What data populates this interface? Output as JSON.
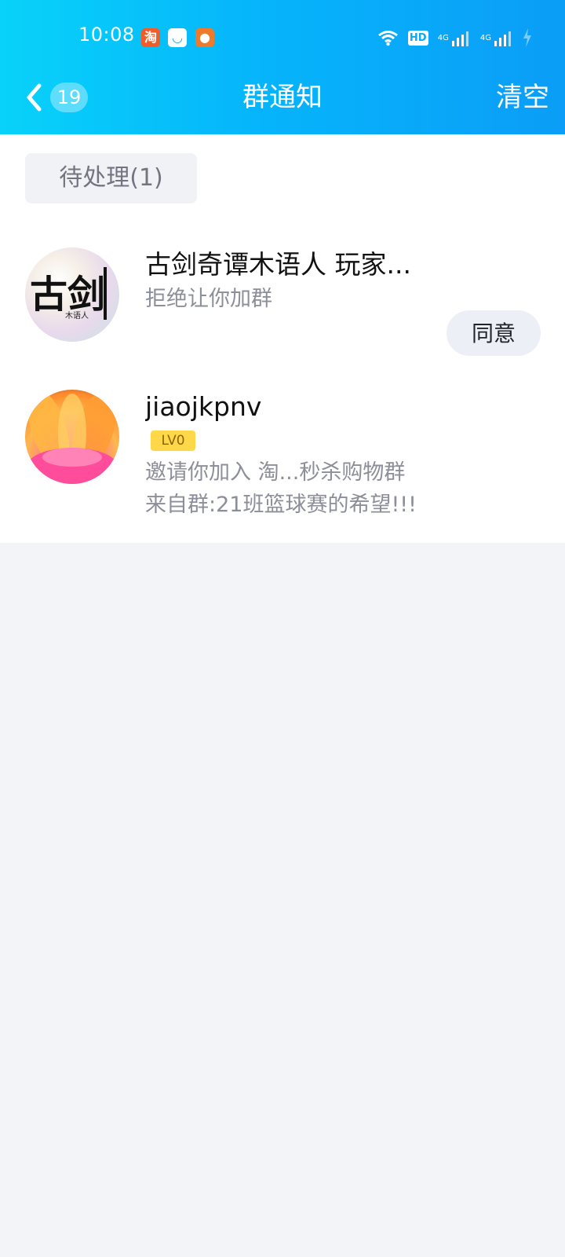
{
  "status_bar": {
    "time": "10:08",
    "app_icons": [
      {
        "name": "taobao-icon",
        "glyph": "淘"
      },
      {
        "name": "qq-icon",
        "glyph": "◡"
      },
      {
        "name": "uc-browser-icon",
        "glyph": "●"
      }
    ],
    "hd_label": "HD",
    "network_labels": [
      "4G",
      "4G"
    ]
  },
  "header": {
    "back_count": "19",
    "title": "群通知",
    "clear_label": "清空"
  },
  "tabs": {
    "pending_label": "待处理(1)"
  },
  "notices": [
    {
      "name": "古剑奇谭木语人 玩家...",
      "description": "拒绝让你加群"
    },
    {
      "name": "jiaojkpnv",
      "level": "LV0",
      "invite": "邀请你加入 淘...秒杀购物群",
      "source": "来自群:21班篮球赛的希望!!!",
      "action_label": "同意"
    }
  ],
  "avatar_texts": {
    "gujian_big": "古剑",
    "gujian_small": "木语人"
  },
  "colors": {
    "header_start": "#08d2f9",
    "header_end": "#0b9df7",
    "background": "#f3f4f8",
    "secondary_text": "#8c8f99",
    "level_badge": "#ffd84a"
  }
}
